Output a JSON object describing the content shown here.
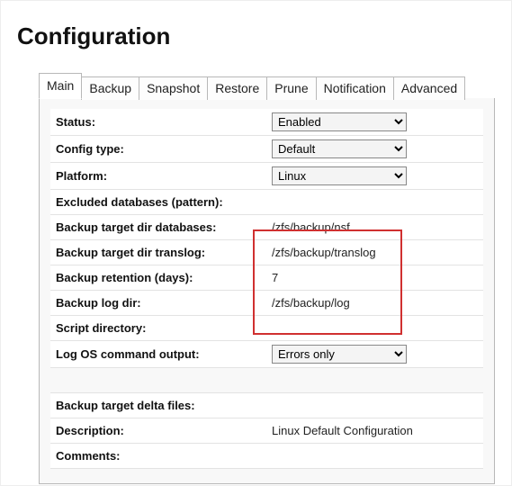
{
  "title": "Configuration",
  "tabs": [
    "Main",
    "Backup",
    "Snapshot",
    "Restore",
    "Prune",
    "Notification",
    "Advanced"
  ],
  "activeTab": "Main",
  "fields": {
    "status": {
      "label": "Status:",
      "value": "Enabled"
    },
    "configType": {
      "label": "Config type:",
      "value": "Default"
    },
    "platform": {
      "label": "Platform:",
      "value": "Linux"
    },
    "excluded": {
      "label": "Excluded databases (pattern):",
      "value": ""
    },
    "targetDirDb": {
      "label": "Backup target dir databases:",
      "value": "/zfs/backup/nsf"
    },
    "targetDirTranslog": {
      "label": "Backup target dir translog:",
      "value": "/zfs/backup/translog"
    },
    "retention": {
      "label": "Backup retention (days):",
      "value": "7"
    },
    "logDir": {
      "label": "Backup log dir:",
      "value": "/zfs/backup/log"
    },
    "scriptDir": {
      "label": "Script directory:",
      "value": ""
    },
    "logOsCmd": {
      "label": "Log OS command output:",
      "value": "Errors only"
    },
    "deltaFiles": {
      "label": "Backup target delta files:",
      "value": ""
    },
    "description": {
      "label": "Description:",
      "value": "Linux Default Configuration"
    },
    "comments": {
      "label": "Comments:",
      "value": ""
    }
  }
}
